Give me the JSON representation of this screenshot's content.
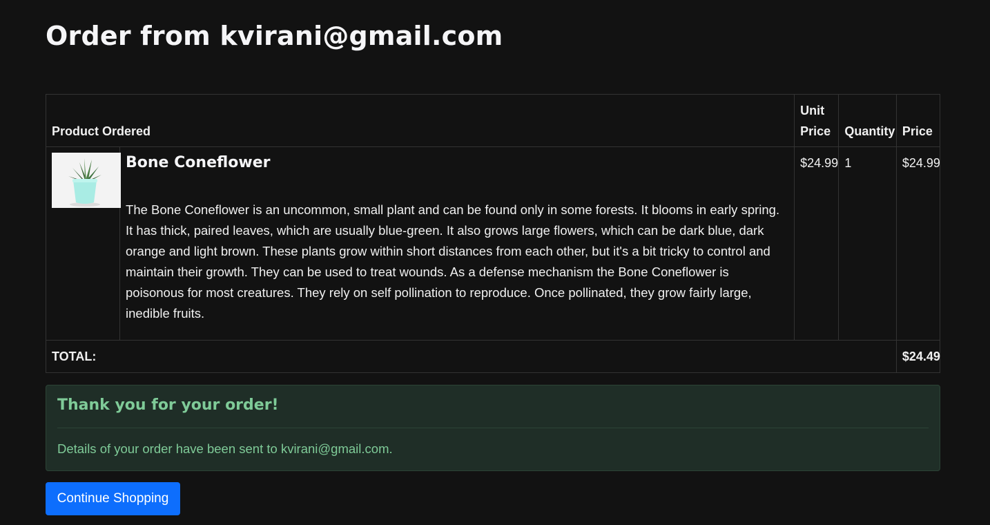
{
  "page": {
    "title": "Order from kvirani@gmail.com"
  },
  "table": {
    "headers": {
      "product": "Product Ordered",
      "unit_price": "Unit Price",
      "quantity": "Quantity",
      "price": "Price"
    },
    "items": [
      {
        "name": "Bone Coneflower",
        "description": "The Bone Coneflower is an uncommon, small plant and can be found only in some forests. It blooms in early spring. It has thick, paired leaves, which are usually blue-green. It also grows large flowers, which can be dark blue, dark orange and light brown. These plants grow within short distances from each other, but it's a bit tricky to control and maintain their growth. They can be used to treat wounds. As a defense mechanism the Bone Coneflower is poisonous for most creatures. They rely on self pollination to reproduce. Once pollinated, they grow fairly large, inedible fruits.",
        "unit_price": "$24.99",
        "quantity": "1",
        "price": "$24.99",
        "image_icon": "potted-succulent"
      }
    ],
    "total_label": "TOTAL:",
    "total_value": "$24.49"
  },
  "alert": {
    "heading": "Thank you for your order!",
    "text": "Details of your order have been sent to kvirani@gmail.com."
  },
  "button": {
    "continue_label": "Continue Shopping"
  },
  "colors": {
    "background": "#121212",
    "alert_background": "#1f2e27",
    "alert_text": "#7fcb98",
    "primary_button": "#0d6efd"
  }
}
